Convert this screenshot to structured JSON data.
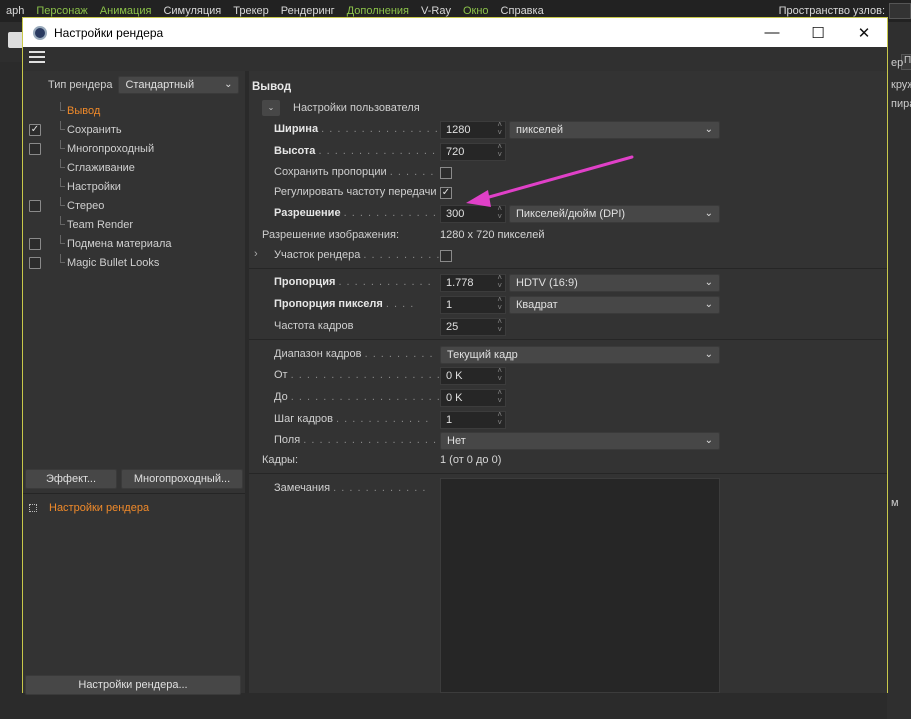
{
  "menubar": {
    "items": [
      {
        "label": "aph",
        "hl": false
      },
      {
        "label": "Персонаж",
        "hl": true
      },
      {
        "label": "Анимация",
        "hl": true
      },
      {
        "label": "Симуляция",
        "hl": false
      },
      {
        "label": "Трекер",
        "hl": false
      },
      {
        "label": "Рендеринг",
        "hl": false
      },
      {
        "label": "Дополнения",
        "hl": true
      },
      {
        "label": "V-Ray",
        "hl": false
      },
      {
        "label": "Окно",
        "hl": true
      },
      {
        "label": "Справка",
        "hl": false
      }
    ],
    "node_space_label": "Пространство узлов:"
  },
  "bg_right": {
    "tab": "П",
    "line1": "ер",
    "line2": "круж",
    "line3": "пира",
    "line4": "м"
  },
  "dialog": {
    "title": "Настройки рендера",
    "render_type_label": "Тип рендера",
    "render_type_value": "Стандартный",
    "tree": [
      {
        "label": "Вывод",
        "has_checkbox": false,
        "checked": false,
        "active": true
      },
      {
        "label": "Сохранить",
        "has_checkbox": true,
        "checked": true,
        "active": false
      },
      {
        "label": "Многопроходный",
        "has_checkbox": true,
        "checked": false,
        "active": false
      },
      {
        "label": "Сглаживание",
        "has_checkbox": false,
        "checked": false,
        "active": false
      },
      {
        "label": "Настройки",
        "has_checkbox": false,
        "checked": false,
        "active": false
      },
      {
        "label": "Стерео",
        "has_checkbox": true,
        "checked": false,
        "active": false
      },
      {
        "label": "Team Render",
        "has_checkbox": false,
        "checked": false,
        "active": false
      },
      {
        "label": "Подмена материала",
        "has_checkbox": true,
        "checked": false,
        "active": false
      },
      {
        "label": "Magic Bullet Looks",
        "has_checkbox": true,
        "checked": false,
        "active": false
      }
    ],
    "effects_button": "Эффект...",
    "multipass_button": "Многопроходный...",
    "settings_node": "Настройки рендера",
    "bottom_button": "Настройки рендера...",
    "output": {
      "section_title": "Вывод",
      "user_settings": "Настройки пользователя",
      "width_label": "Ширина",
      "width_value": "1280",
      "width_unit": "пикселей",
      "height_label": "Высота",
      "height_value": "720",
      "keep_ratio_label": "Сохранить пропорции",
      "adjust_fps_label": "Регулировать частоту передачи",
      "resolution_label": "Разрешение",
      "resolution_value": "300",
      "resolution_unit": "Пикселей/дюйм (DPI)",
      "image_res_label": "Разрешение изображения:",
      "image_res_value": "1280 x 720 пикселей",
      "region_label": "Участок рендера",
      "aspect_label": "Пропорция",
      "aspect_value": "1.778",
      "aspect_preset": "HDTV (16:9)",
      "pixel_aspect_label": "Пропорция пикселя",
      "pixel_aspect_value": "1",
      "pixel_aspect_preset": "Квадрат",
      "fps_label": "Частота кадров",
      "fps_value": "25",
      "frame_range_label": "Диапазон кадров",
      "frame_range_value": "Текущий кадр",
      "from_label": "От",
      "from_value": "0 K",
      "to_label": "До",
      "to_value": "0 K",
      "step_label": "Шаг кадров",
      "step_value": "1",
      "fields_label": "Поля",
      "fields_value": "Нет",
      "frames_label": "Кадры:",
      "frames_value": "1 (от 0 до 0)",
      "notes_label": "Замечания"
    }
  },
  "colors": {
    "accent_orange": "#f08a2a",
    "menu_highlight": "#8bc24a",
    "arrow": "#e040c8",
    "dialog_border": "#c8c84a"
  }
}
